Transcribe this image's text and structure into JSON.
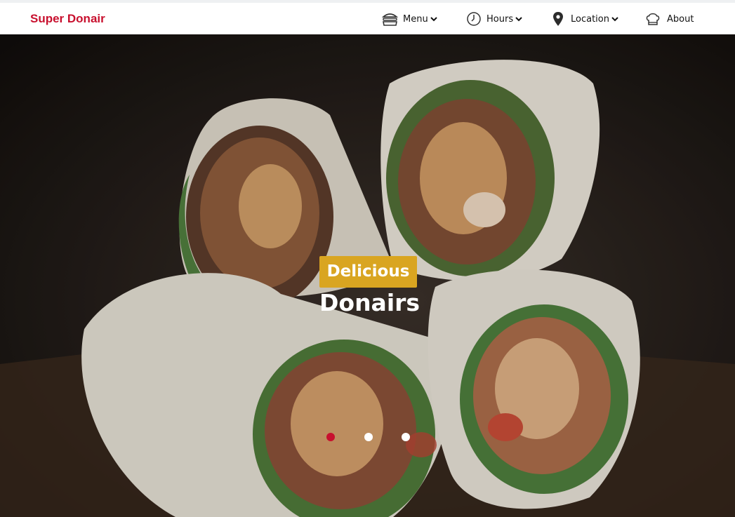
{
  "brand": {
    "name": "Super Donair",
    "color": "#c8102e"
  },
  "nav": {
    "items": [
      {
        "label": "Menu",
        "icon": "burger-icon",
        "dropdown": true
      },
      {
        "label": "Hours",
        "icon": "clock-icon",
        "dropdown": true
      },
      {
        "label": "Location",
        "icon": "map-pin-icon",
        "dropdown": true
      },
      {
        "label": "About",
        "icon": "chef-hat-icon",
        "dropdown": false
      }
    ]
  },
  "hero": {
    "badge": "Delicious",
    "title": "Donairs",
    "badge_color": "#d9a521",
    "slides": 3,
    "active_slide": 1,
    "active_dot_color": "#c8102e"
  }
}
